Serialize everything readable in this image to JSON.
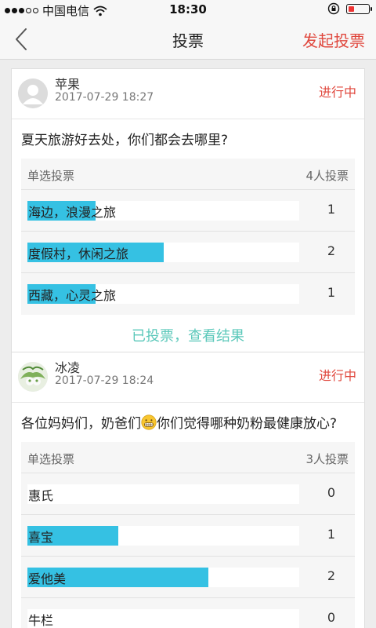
{
  "status_bar": {
    "carrier": "中国电信",
    "time": "18:30"
  },
  "nav": {
    "title": "投票",
    "action": "发起投票",
    "back_icon": "chevron-left-icon"
  },
  "colors": {
    "accent_red": "#e0483e",
    "bar_blue": "#35c1e3",
    "link_teal": "#5bc8ba"
  },
  "polls": [
    {
      "user": "苹果",
      "time": "2017-07-29 18:27",
      "status": "进行中",
      "question": "夏天旅游好去处，你们都会去哪里?",
      "type": "单选投票",
      "total": "4人投票",
      "options": [
        {
          "label": "海边，浪漫之旅",
          "count": "1",
          "share": 0.25
        },
        {
          "label": "度假村，休闲之旅",
          "count": "2",
          "share": 0.5
        },
        {
          "label": "西藏，心灵之旅",
          "count": "1",
          "share": 0.25
        }
      ],
      "result_link": "已投票，查看结果"
    },
    {
      "user": "冰凌",
      "time": "2017-07-29 18:24",
      "status": "进行中",
      "question_part1": "各位妈妈们，奶爸们",
      "question_emoji": "grinning-face-icon",
      "question_part2": "你们觉得哪种奶粉最健康放心?",
      "type": "单选投票",
      "total": "3人投票",
      "options": [
        {
          "label": "惠氏",
          "count": "0",
          "share": 0
        },
        {
          "label": "喜宝",
          "count": "1",
          "share": 0.3333
        },
        {
          "label": "爱他美",
          "count": "2",
          "share": 0.6667
        },
        {
          "label": "牛栏",
          "count": "0",
          "share": 0
        }
      ]
    }
  ]
}
